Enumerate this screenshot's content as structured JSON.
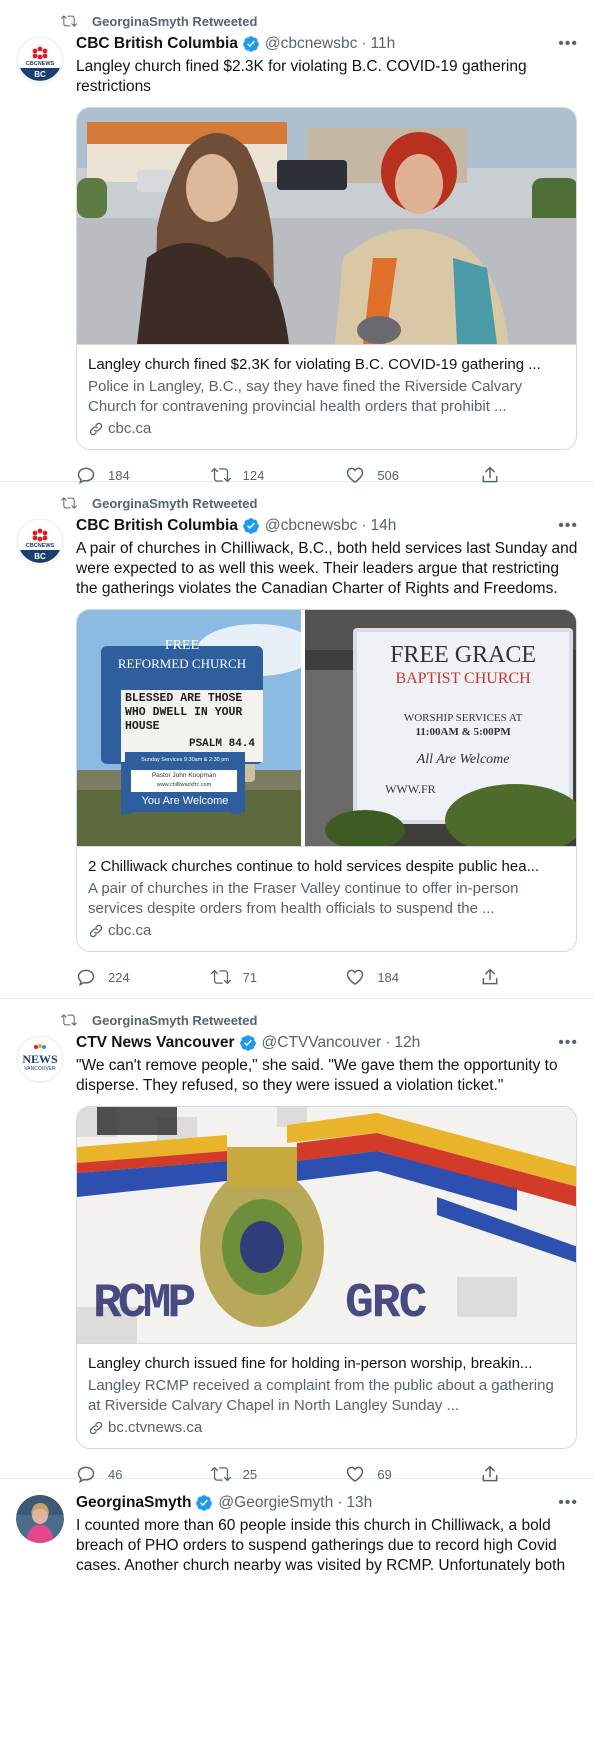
{
  "tweets": [
    {
      "retweet_label": "GeorginaSmyth Retweeted",
      "name": "CBC British Columbia",
      "handle": "@cbcnewsbc",
      "time": "11h",
      "text": "Langley church fined $2.3K for violating B.C. COVID-19 gathering restrictions",
      "card": {
        "title": "Langley church fined $2.3K for violating B.C. COVID-19 gathering ...",
        "description": "Police in Langley, B.C., say they have fined the Riverside Calvary Church for contravening provincial health orders that prohibit ...",
        "domain": "cbc.ca"
      },
      "replies": "184",
      "retweets": "124",
      "likes": "506",
      "avatar_label": "BC"
    },
    {
      "retweet_label": "GeorginaSmyth Retweeted",
      "name": "CBC British Columbia",
      "handle": "@cbcnewsbc",
      "time": "14h",
      "text": "A pair of churches in Chilliwack, B.C., both held services last Sunday and were expected to as well this week. Their leaders argue that restricting the gatherings violates the Canadian Charter of Rights and Freedoms.",
      "card": {
        "title": "2 Chilliwack churches continue to hold services despite public hea...",
        "description": "A pair of churches in the Fraser Valley continue to offer in-person services despite orders from health officials to suspend the ...",
        "domain": "cbc.ca",
        "sign_left": {
          "top": "FREE",
          "middle": "REFORMED CHURCH",
          "message": "BLESSED ARE THOSE WHO DWELL IN YOUR HOUSE",
          "verse": "PSALM 84.4",
          "services": "Sunday Services 9:30am & 2:30 pm",
          "pastor": "Pastor John Koopman",
          "web": "www.chilliwackfrc.com",
          "welcome": "You Are Welcome"
        },
        "sign_right": {
          "line1": "FREE GRACE",
          "line2": "BAPTIST CHURCH",
          "line3": "WORSHIP SERVICES AT",
          "line4": "11:00AM & 5:00PM",
          "line5": "All Are Welcome",
          "line6": "WWW.FR"
        }
      },
      "replies": "224",
      "retweets": "71",
      "likes": "184",
      "avatar_label": "BC"
    },
    {
      "retweet_label": "GeorginaSmyth Retweeted",
      "name": "CTV News Vancouver",
      "handle": "@CTVVancouver",
      "time": "12h",
      "text": "\"We can't remove people,\" she said. \"We gave them the opportunity to disperse. They refused, so they were issued a violation ticket.\"",
      "card": {
        "title": "Langley church issued fine for holding in-person worship, breakin...",
        "description": "Langley RCMP received a complaint from the public about a gathering at Riverside Calvary Chapel in North Langley Sunday ...",
        "domain": "bc.ctvnews.ca",
        "img_left": "RCMP",
        "img_right": "GRC"
      },
      "replies": "46",
      "retweets": "25",
      "likes": "69",
      "avatar_label": "NEWS",
      "avatar_sub": "VANCOUVER"
    },
    {
      "name": "GeorginaSmyth",
      "handle": "@GeorgieSmyth",
      "time": "13h",
      "text": "I counted more than 60 people inside this church in Chilliwack, a bold breach of PHO orders to suspend gatherings due to record high Covid cases. Another church nearby was visited by RCMP. Unfortunately both"
    }
  ],
  "colors": {
    "accent": "#1d9bf0",
    "muted": "#536471",
    "border": "#cfd9de",
    "cbc_red": "#e31b23",
    "cbc_navy": "#1d3f6e"
  },
  "icons": {
    "retweet": "retweet-icon",
    "verified": "verified-badge-icon",
    "more": "more-icon",
    "reply": "reply-icon",
    "like": "heart-icon",
    "share": "share-icon",
    "link": "link-icon"
  }
}
